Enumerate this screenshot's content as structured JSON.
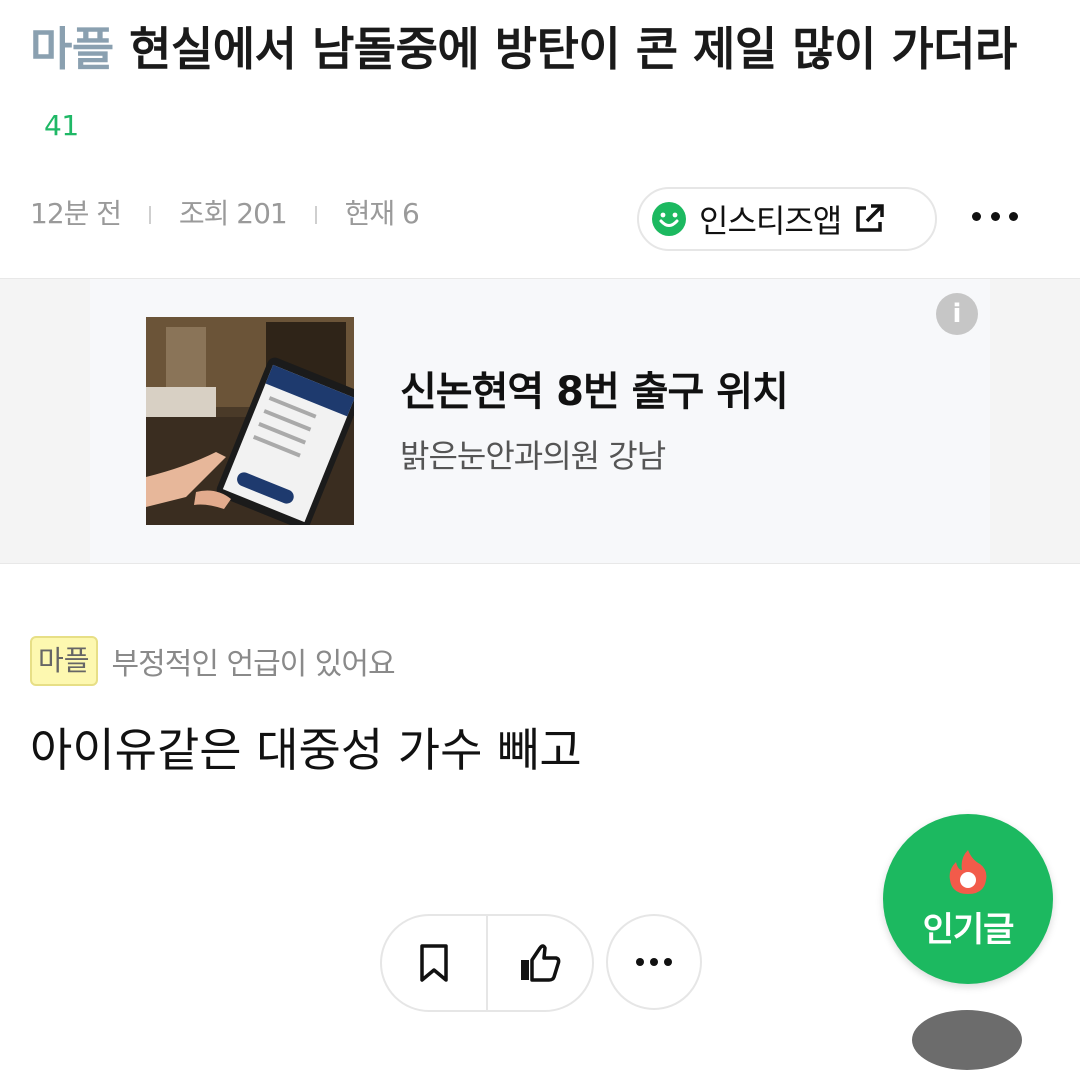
{
  "post": {
    "category": "마플",
    "title": "현실에서 남돌중에 방탄이 콘 제일 많이 가더라",
    "comment_count": "41",
    "time": "12분 전",
    "views": "조회 201",
    "current": "현재 6"
  },
  "header": {
    "app_button_label": "인스티즈앱",
    "more_icon": "more-horizontal-icon"
  },
  "ad": {
    "title": "신논현역 8번 출구 위치",
    "subtitle": "밝은눈안과의원 강남",
    "info_icon": "i"
  },
  "notice": {
    "badge": "마플",
    "text": "부정적인 언급이 있어요"
  },
  "content": {
    "body": "아이유같은 대중성 가수 빼고"
  },
  "floating": {
    "hot_label": "인기글"
  },
  "colors": {
    "accent_green": "#1cb960",
    "category_gray": "#8aa0b0",
    "notice_yellow": "#fdf8b0"
  }
}
